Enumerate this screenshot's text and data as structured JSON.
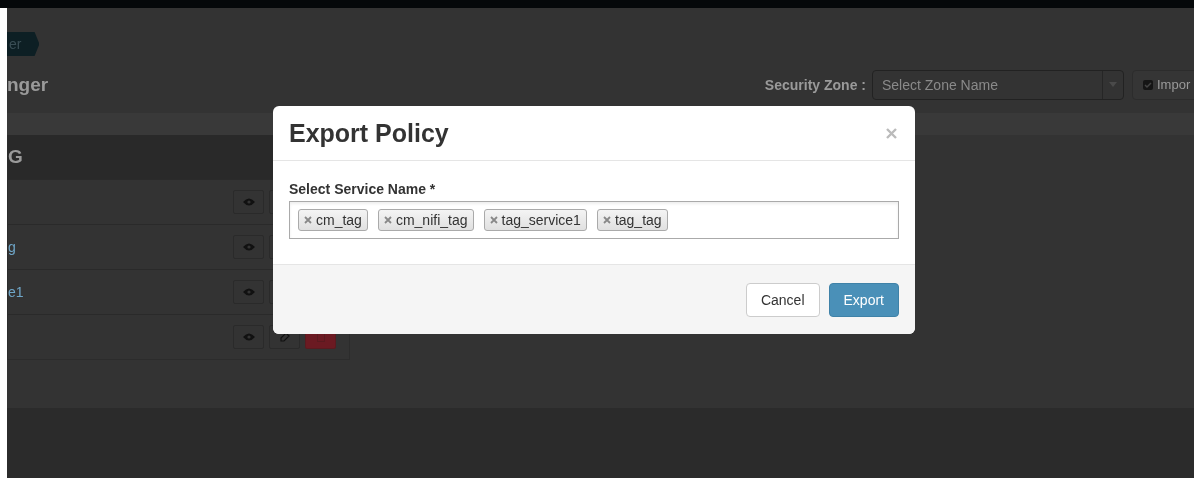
{
  "breadcrumb": "er",
  "page_title": "nger",
  "security_zone": {
    "label": "Security Zone :",
    "placeholder": "Select Zone Name"
  },
  "import_button": "Impor",
  "table": {
    "header": "G",
    "rows": [
      {},
      {
        "name": "g"
      },
      {
        "name": "e1"
      },
      {}
    ]
  },
  "modal": {
    "title": "Export Policy",
    "field_label": "Select Service Name *",
    "selected_services": [
      "cm_tag",
      "cm_nifi_tag",
      "tag_service1",
      "tag_tag"
    ],
    "buttons": [
      {
        "label": "Cancel",
        "kind": "default"
      },
      {
        "label": "Export",
        "kind": "primary"
      }
    ]
  }
}
